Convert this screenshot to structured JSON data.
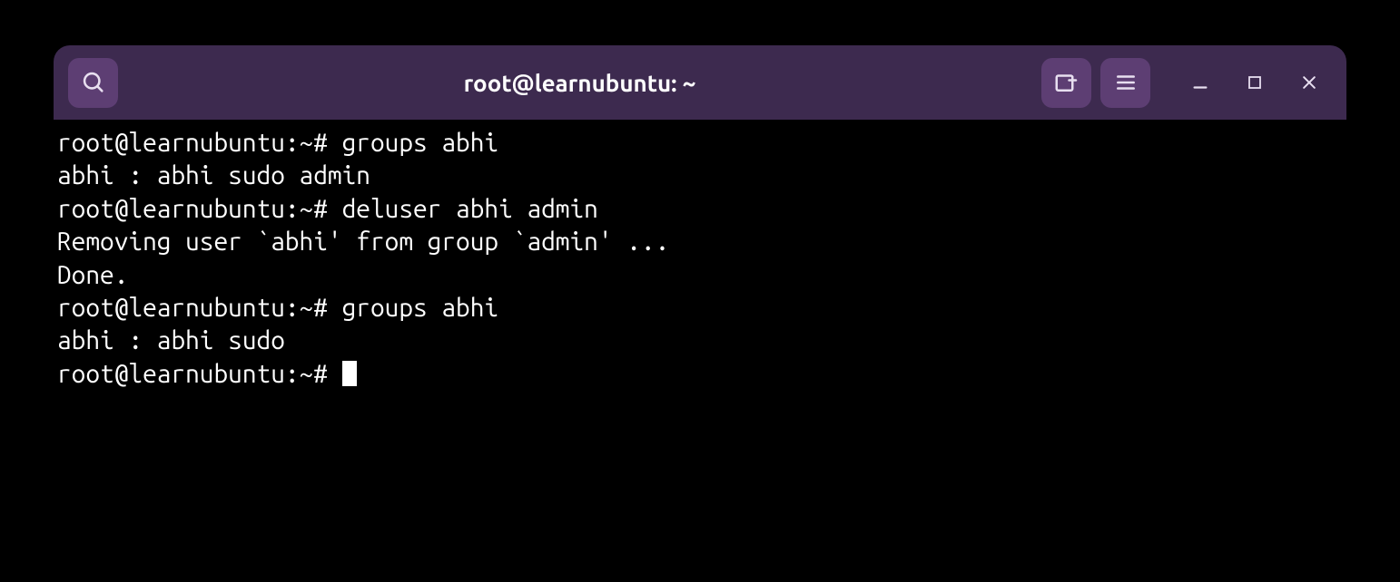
{
  "window": {
    "title": "root@learnubuntu: ~"
  },
  "terminal": {
    "prompt": "root@learnubuntu:~# ",
    "lines": [
      "root@learnubuntu:~# groups abhi",
      "abhi : abhi sudo admin",
      "root@learnubuntu:~# deluser abhi admin",
      "Removing user `abhi' from group `admin' ...",
      "Done.",
      "root@learnubuntu:~# groups abhi",
      "abhi : abhi sudo"
    ],
    "current_prompt": "root@learnubuntu:~# "
  }
}
